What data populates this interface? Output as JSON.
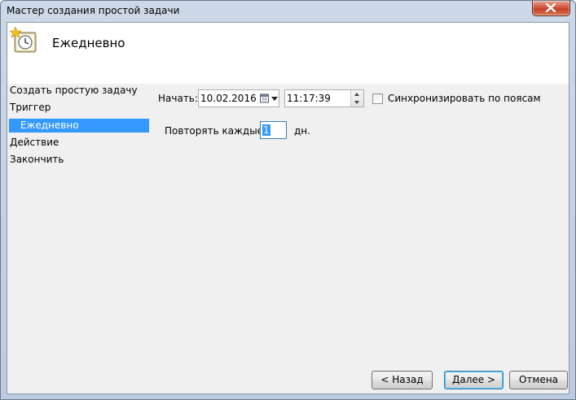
{
  "window": {
    "title": "Мастер создания простой задачи"
  },
  "header": {
    "title": "Ежедневно",
    "icon": "scheduled-task-clock-icon"
  },
  "steps": [
    {
      "label": "Создать простую задачу",
      "selected": false
    },
    {
      "label": "Триггер",
      "selected": false
    },
    {
      "label": "Ежедневно",
      "selected": true
    },
    {
      "label": "Действие",
      "selected": false
    },
    {
      "label": "Закончить",
      "selected": false
    }
  ],
  "trigger": {
    "start_label": "Начать:",
    "start_date": "10.02.2016",
    "start_time": "11:17:39",
    "sync_label": "Синхронизировать по поясам",
    "sync_checked": false,
    "repeat_label": "Повторять каждые:",
    "repeat_value": "1",
    "repeat_unit": "дн."
  },
  "buttons": {
    "back": "< Назад",
    "next": "Далее >",
    "cancel": "Отмена"
  },
  "colors": {
    "selection": "#3399ff",
    "client_bg": "#f0f0f0",
    "close_button": "#c33f26"
  }
}
